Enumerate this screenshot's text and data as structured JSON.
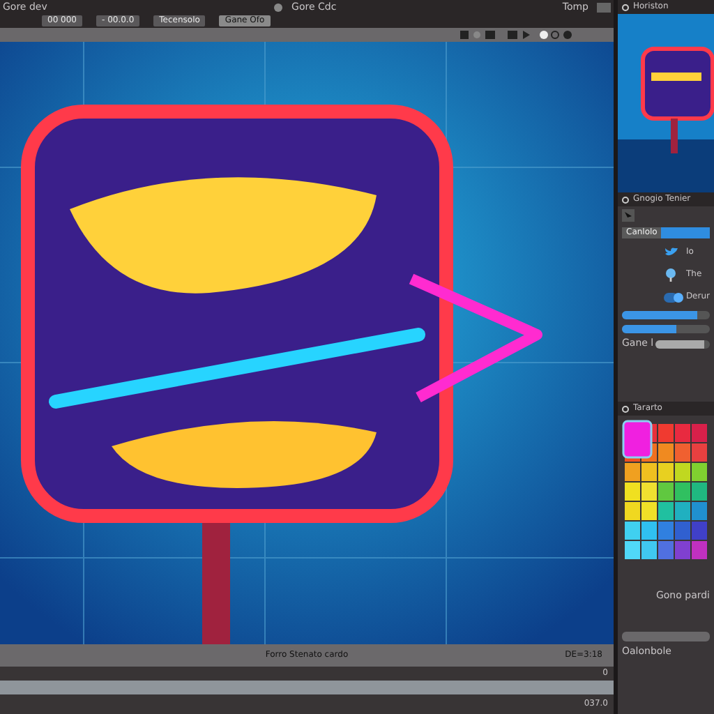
{
  "menu_bar": {
    "title": "Gore dev",
    "document": "Gore Cdc",
    "mode": "Tomp"
  },
  "toolbar": {
    "buttons": [
      {
        "label": "00 000"
      },
      {
        "label": "- 00.0.0"
      },
      {
        "label": "Tecensolo"
      }
    ],
    "tabs": [
      {
        "label": "Gane Ofo",
        "selected": true
      }
    ]
  },
  "status_bar": {
    "caption": "Forro Stenato cardo",
    "code": "DE=3:18"
  },
  "timeline": {
    "rows": [
      {
        "value": "0"
      },
      {
        "value": "037.0"
      }
    ]
  },
  "navigator": {
    "title": "Horiston"
  },
  "inspector": {
    "title": "Gnogio Tenier",
    "field_label": "Canlolo",
    "rows": [
      {
        "kind": "bird",
        "label": "Io"
      },
      {
        "kind": "pin",
        "label": "The"
      },
      {
        "kind": "toggle",
        "label": "Derur",
        "on": true
      }
    ],
    "sliders": [
      {
        "level": 0.85
      },
      {
        "level": 0.62
      }
    ],
    "gain": {
      "label": "Gane l",
      "level": 0.9
    }
  },
  "swatches": {
    "title": "Tararto",
    "label": "Gono pardi",
    "footer": "Oalonbole"
  }
}
